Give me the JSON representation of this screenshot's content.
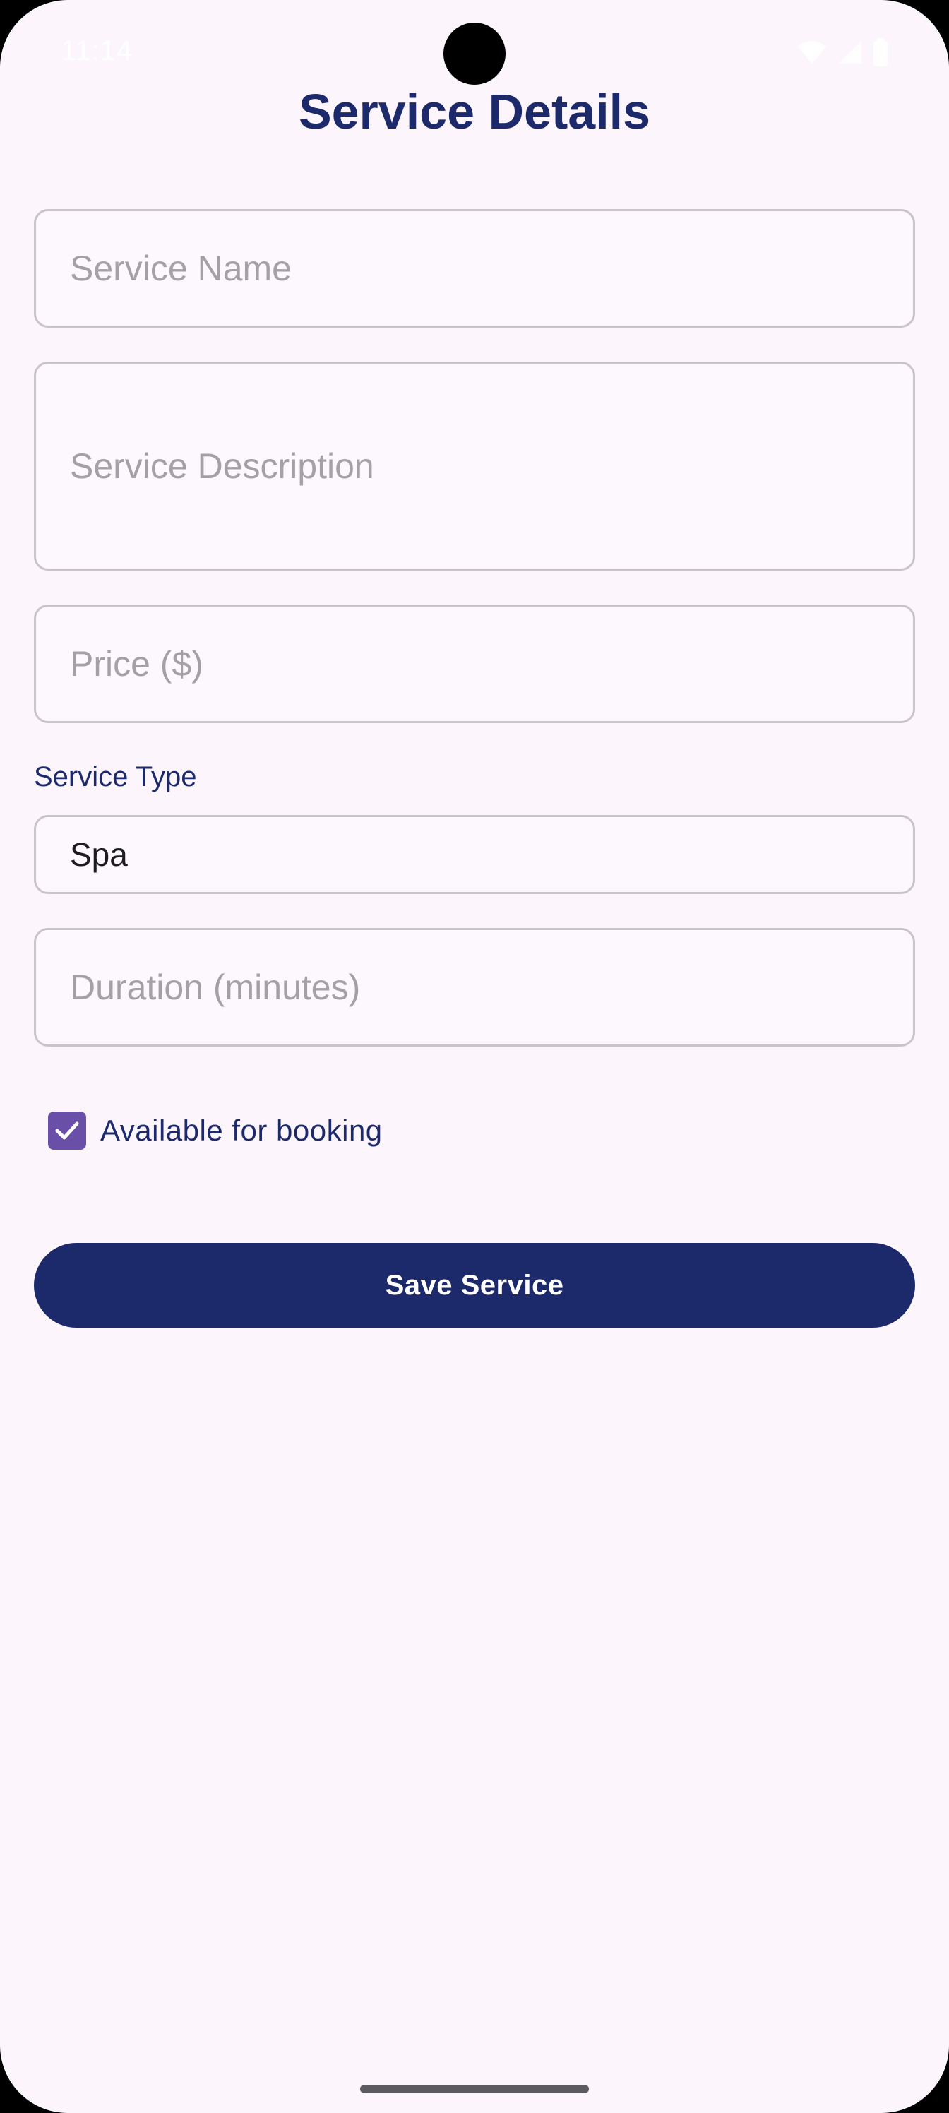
{
  "status_bar": {
    "time": "11:14",
    "icons": [
      "wifi-icon",
      "signal-icon",
      "battery-icon"
    ]
  },
  "page": {
    "title": "Service Details"
  },
  "form": {
    "service_name": {
      "placeholder": "Service Name",
      "value": ""
    },
    "service_description": {
      "placeholder": "Service Description",
      "value": ""
    },
    "price": {
      "placeholder": "Price ($)",
      "value": ""
    },
    "service_type": {
      "label": "Service Type",
      "selected": "Spa"
    },
    "duration": {
      "placeholder": "Duration (minutes)",
      "value": ""
    },
    "available": {
      "label": "Available for booking",
      "checked": true
    },
    "save_label": "Save Service"
  },
  "colors": {
    "background": "#fcf5fc",
    "primary": "#1c2a6c",
    "checkbox": "#6a4fa8",
    "field_border": "#c8c4ca",
    "placeholder": "#a3a0a6"
  }
}
